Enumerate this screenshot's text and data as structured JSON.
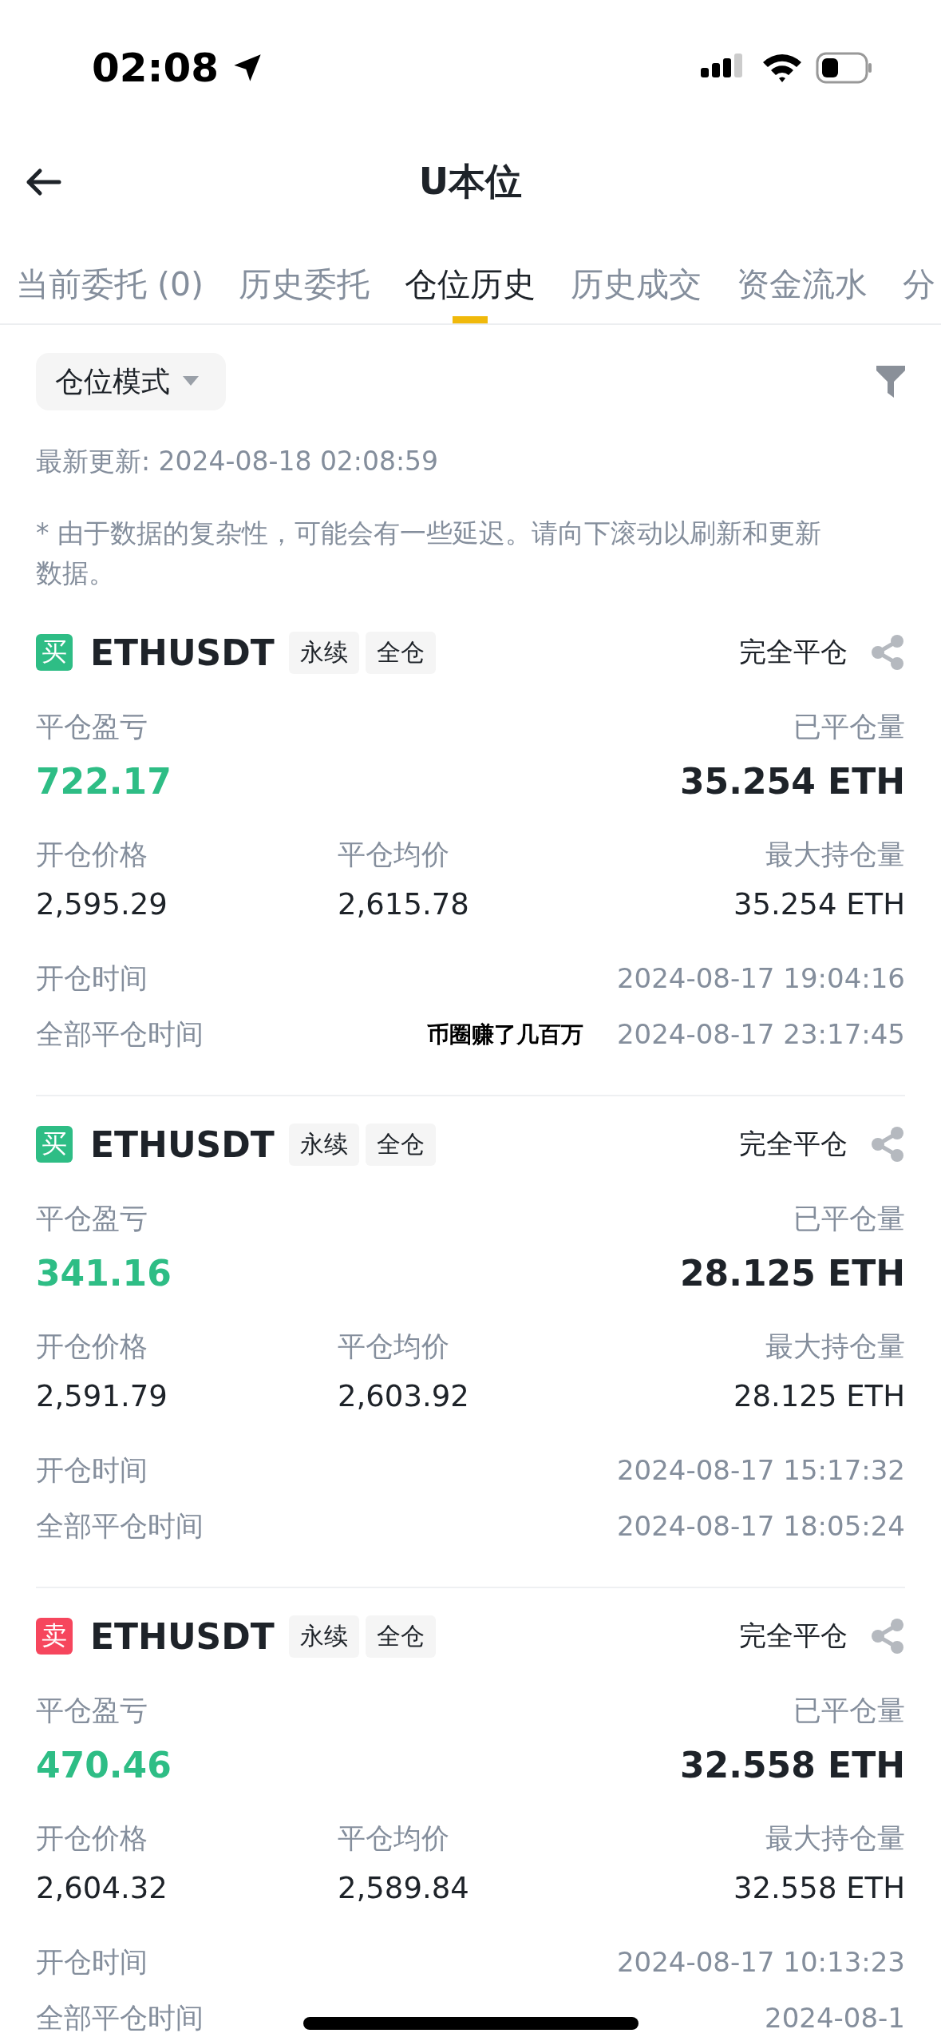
{
  "status_bar": {
    "time": "02:08"
  },
  "header": {
    "title": "U本位"
  },
  "tabs": [
    {
      "label": "当前委托 (0)",
      "selected": false
    },
    {
      "label": "历史委托",
      "selected": false
    },
    {
      "label": "仓位历史",
      "selected": true
    },
    {
      "label": "历史成交",
      "selected": false
    },
    {
      "label": "资金流水",
      "selected": false
    },
    {
      "label": "分",
      "selected": false
    }
  ],
  "mode_dropdown": {
    "label": "仓位模式"
  },
  "last_update": "最新更新: 2024-08-18 02:08:59",
  "note": "* 由于数据的复杂性，可能会有一些延迟。请向下滚动以刷新和更新数据。",
  "caption": "币圈赚了几百万",
  "positions": [
    {
      "kind": "buy",
      "side_label": "买",
      "symbol": "ETHUSDT",
      "tags": [
        "永续",
        "全仓"
      ],
      "status": "完全平仓",
      "pnl_label": "平仓盈亏",
      "pnl": "722.17",
      "closed_qty_label": "已平仓量",
      "closed_qty": "35.254 ETH",
      "open_price_label": "开仓价格",
      "open_price": "2,595.29",
      "close_avg_label": "平仓均价",
      "close_avg": "2,615.78",
      "max_qty_label": "最大持仓量",
      "max_qty": "35.254 ETH",
      "open_time_label": "开仓时间",
      "open_time": "2024-08-17 19:04:16",
      "close_time_label": "全部平仓时间",
      "close_time": "2024-08-17 23:17:45"
    },
    {
      "kind": "buy",
      "side_label": "买",
      "symbol": "ETHUSDT",
      "tags": [
        "永续",
        "全仓"
      ],
      "status": "完全平仓",
      "pnl_label": "平仓盈亏",
      "pnl": "341.16",
      "closed_qty_label": "已平仓量",
      "closed_qty": "28.125 ETH",
      "open_price_label": "开仓价格",
      "open_price": "2,591.79",
      "close_avg_label": "平仓均价",
      "close_avg": "2,603.92",
      "max_qty_label": "最大持仓量",
      "max_qty": "28.125 ETH",
      "open_time_label": "开仓时间",
      "open_time": "2024-08-17 15:17:32",
      "close_time_label": "全部平仓时间",
      "close_time": "2024-08-17 18:05:24"
    },
    {
      "kind": "sell",
      "side_label": "卖",
      "symbol": "ETHUSDT",
      "tags": [
        "永续",
        "全仓"
      ],
      "status": "完全平仓",
      "pnl_label": "平仓盈亏",
      "pnl": "470.46",
      "closed_qty_label": "已平仓量",
      "closed_qty": "32.558 ETH",
      "open_price_label": "开仓价格",
      "open_price": "2,604.32",
      "close_avg_label": "平仓均价",
      "close_avg": "2,589.84",
      "max_qty_label": "最大持仓量",
      "max_qty": "32.558 ETH",
      "open_time_label": "开仓时间",
      "open_time": "2024-08-17 10:13:23",
      "close_time_label": "全部平仓时间",
      "close_time": "2024-08-1"
    }
  ]
}
